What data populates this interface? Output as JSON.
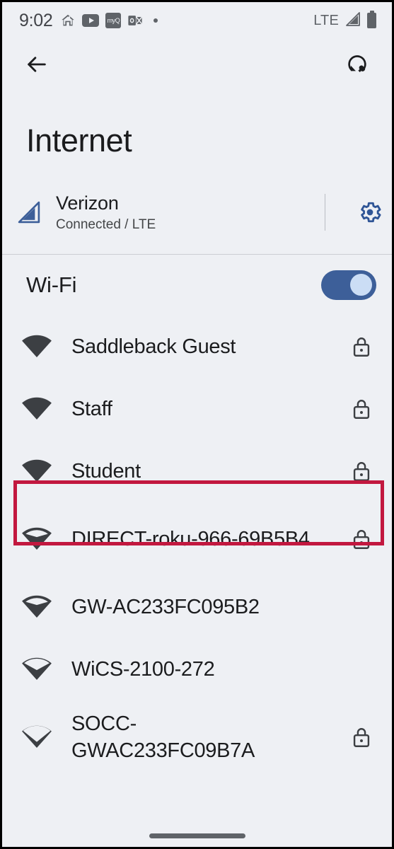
{
  "status_bar": {
    "time": "9:02",
    "icons": [
      {
        "name": "home-icon",
        "label": "home"
      },
      {
        "name": "youtube-icon",
        "label": "YouTube"
      },
      {
        "name": "myq-icon",
        "label": "myQ"
      },
      {
        "name": "outlook-icon",
        "label": "Outlook"
      },
      {
        "name": "more-notifications-dot",
        "label": "•"
      }
    ],
    "myq_text": "myQ",
    "network_type": "LTE",
    "signal_icon": "cellular-signal-icon",
    "battery_icon": "battery-full-icon"
  },
  "app_bar": {
    "back_icon": "back-arrow-icon",
    "reset_icon": "reset-network-settings-icon"
  },
  "page": {
    "title": "Internet"
  },
  "carrier": {
    "signal_icon": "cellular-signal-icon",
    "name": "Verizon",
    "status": "Connected / LTE",
    "settings_icon": "gear-icon",
    "accent_color": "#3d5f99"
  },
  "wifi": {
    "label": "Wi-Fi",
    "toggle_state": "on",
    "toggle_track_color": "#3d5f99",
    "toggle_thumb_color": "#cbddf5"
  },
  "networks": [
    {
      "ssid": "Saddleback Guest",
      "signal": 4,
      "secured": true,
      "highlighted": false
    },
    {
      "ssid": "Staff",
      "signal": 4,
      "secured": true,
      "highlighted": false
    },
    {
      "ssid": "Student",
      "signal": 4,
      "secured": true,
      "highlighted": true
    },
    {
      "ssid": "DIRECT-roku-966-69B5B4",
      "signal": 3,
      "secured": true,
      "highlighted": false
    },
    {
      "ssid": "GW-AC233FC095B2",
      "signal": 3,
      "secured": false,
      "highlighted": false
    },
    {
      "ssid": "WiCS-2100-272",
      "signal": 2,
      "secured": false,
      "highlighted": false
    },
    {
      "ssid": "SOCC-GWAC233FC09B7A",
      "signal": 1,
      "secured": true,
      "highlighted": false
    }
  ],
  "highlight": {
    "color": "#c2183f",
    "target_ssid": "Student"
  },
  "nav": {
    "gesture_bar": "home-gesture-bar"
  }
}
